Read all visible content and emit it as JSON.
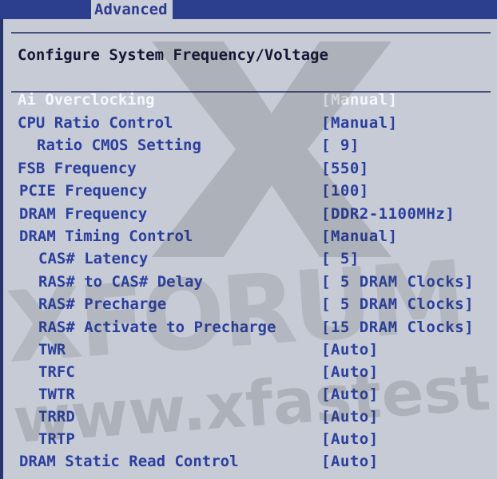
{
  "tab_label": "Advanced",
  "header_title": "Configure System Frequency/Voltage",
  "items": [
    {
      "label": "Ai Overclocking",
      "value": "[Manual]"
    },
    {
      "label": "CPU Ratio Control",
      "value": "[Manual]"
    },
    {
      "label": "Ratio CMOS Setting",
      "value": "[ 9]"
    },
    {
      "label": "FSB Frequency",
      "value": "[550]"
    },
    {
      "label": "PCIE Frequency",
      "value": "[100]"
    },
    {
      "label": "DRAM Frequency",
      "value": "[DDR2-1100MHz]"
    },
    {
      "label": "DRAM Timing Control",
      "value": "[Manual]"
    },
    {
      "label": "CAS# Latency",
      "value": "[ 5]"
    },
    {
      "label": "RAS# to CAS# Delay",
      "value": "[ 5 DRAM Clocks]"
    },
    {
      "label": "RAS# Precharge",
      "value": "[ 5 DRAM Clocks]"
    },
    {
      "label": "RAS# Activate to Precharge",
      "value": "[15 DRAM Clocks]"
    },
    {
      "label": "TWR",
      "value": "[Auto]"
    },
    {
      "label": "TRFC",
      "value": "[Auto]"
    },
    {
      "label": "TWTR",
      "value": "[Auto]"
    },
    {
      "label": "TRRD",
      "value": "[Auto]"
    },
    {
      "label": "TRTP",
      "value": "[Auto]"
    },
    {
      "label": "DRAM Static Read Control",
      "value": "[Auto]"
    }
  ],
  "watermark": {
    "line1": "XFORUM",
    "line2": "www.xfastest.com"
  }
}
